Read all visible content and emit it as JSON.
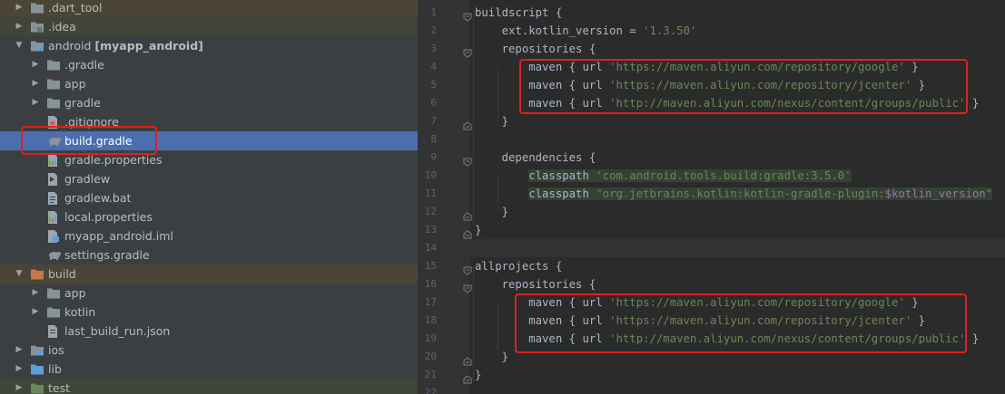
{
  "project_tree": {
    "items": [
      {
        "label": "",
        "name": ".dart_tool",
        "type": "folder",
        "expand": "collapsed"
      },
      {
        "label": "",
        "name": ".idea",
        "type": "folder-idea",
        "expand": "collapsed"
      },
      {
        "label": "[myapp_android]",
        "name": "android",
        "type": "folder-module",
        "expand": "expanded"
      },
      {
        "label": "",
        "name": ".gradle",
        "type": "folder",
        "expand": "collapsed"
      },
      {
        "label": "",
        "name": "app",
        "type": "folder",
        "expand": "collapsed"
      },
      {
        "label": "",
        "name": "gradle",
        "type": "folder",
        "expand": "collapsed"
      },
      {
        "label": "",
        "name": ".gitignore",
        "type": "file-git",
        "expand": "none"
      },
      {
        "label": "",
        "name": "build.gradle",
        "type": "file-gradle",
        "expand": "none"
      },
      {
        "label": "",
        "name": "gradle.properties",
        "type": "file-props",
        "expand": "none"
      },
      {
        "label": "",
        "name": "gradlew",
        "type": "file-exec",
        "expand": "none"
      },
      {
        "label": "",
        "name": "gradlew.bat",
        "type": "file-text",
        "expand": "none"
      },
      {
        "label": "",
        "name": "local.properties",
        "type": "file-props",
        "expand": "none"
      },
      {
        "label": "",
        "name": "myapp_android.iml",
        "type": "file-iml",
        "expand": "none"
      },
      {
        "label": "",
        "name": "settings.gradle",
        "type": "file-gradle",
        "expand": "none"
      },
      {
        "label": "",
        "name": "build",
        "type": "folder-build",
        "expand": "expanded"
      },
      {
        "label": "",
        "name": "app",
        "type": "folder",
        "expand": "collapsed"
      },
      {
        "label": "",
        "name": "kotlin",
        "type": "folder",
        "expand": "collapsed"
      },
      {
        "label": "",
        "name": "last_build_run.json",
        "type": "file-json",
        "expand": "none"
      },
      {
        "label": "",
        "name": "ios",
        "type": "folder-module",
        "expand": "collapsed"
      },
      {
        "label": "",
        "name": "lib",
        "type": "folder-blue",
        "expand": "collapsed"
      },
      {
        "label": "",
        "name": "test",
        "type": "folder-test",
        "expand": "collapsed"
      }
    ]
  },
  "editor": {
    "lines": [
      {
        "n": "1",
        "text": "buildscript {"
      },
      {
        "n": "2",
        "text": "    ext.kotlin_version = ",
        "str": "'1.3.50'"
      },
      {
        "n": "3",
        "text": "    repositories {"
      },
      {
        "n": "4",
        "text": "        maven { url ",
        "str": "'https://maven.aliyun.com/repository/google'",
        "tail": " }"
      },
      {
        "n": "5",
        "text": "        maven { url ",
        "str": "'https://maven.aliyun.com/repository/jcenter'",
        "tail": " }"
      },
      {
        "n": "6",
        "text": "        maven { url ",
        "str": "'http://maven.aliyun.com/nexus/content/groups/public'",
        "tail": " }"
      },
      {
        "n": "7",
        "text": "    }"
      },
      {
        "n": "8",
        "text": ""
      },
      {
        "n": "9",
        "text": "    dependencies {"
      },
      {
        "n": "10",
        "text": "        classpath ",
        "str": "'com.android.tools.build:gradle:3.5.0'"
      },
      {
        "n": "11",
        "text": "        classpath ",
        "str": "\"org.jetbrains.kotlin:kotlin-gradle-plugin:",
        "var": "$kotlin_version",
        "str2": "\""
      },
      {
        "n": "12",
        "text": "    }"
      },
      {
        "n": "13",
        "text": "}"
      },
      {
        "n": "14",
        "text": ""
      },
      {
        "n": "15",
        "text": "allprojects {"
      },
      {
        "n": "16",
        "text": "    repositories {"
      },
      {
        "n": "17",
        "text": "        maven { url ",
        "str": "'https://maven.aliyun.com/repository/google'",
        "tail": " }"
      },
      {
        "n": "18",
        "text": "        maven { url ",
        "str": "'https://maven.aliyun.com/repository/jcenter'",
        "tail": " }"
      },
      {
        "n": "19",
        "text": "        maven { url ",
        "str": "'http://maven.aliyun.com/nexus/content/groups/public'",
        "tail": " }"
      },
      {
        "n": "20",
        "text": "    }"
      },
      {
        "n": "21",
        "text": "}"
      },
      {
        "n": "22",
        "text": ""
      }
    ]
  },
  "colors": {
    "tree_bg": "#3c3f41",
    "selection": "#4b6eaf",
    "annotation_red": "#e02020",
    "string": "#6a8759"
  }
}
